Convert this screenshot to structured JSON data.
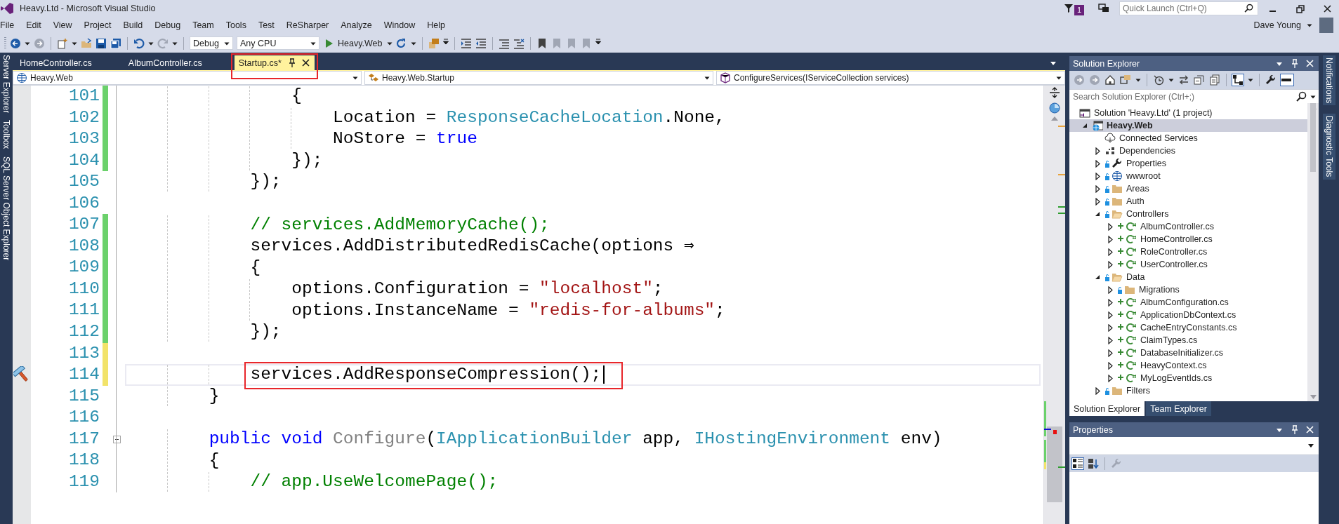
{
  "window": {
    "title": "Heavy.Ltd - Microsoft Visual Studio",
    "notification_count": "1",
    "quick_launch": {
      "placeholder": "Quick Launch (Ctrl+Q)"
    },
    "user": "Dave Young"
  },
  "menu": [
    "File",
    "Edit",
    "View",
    "Project",
    "Build",
    "Debug",
    "Team",
    "Tools",
    "Test",
    "ReSharper",
    "Analyze",
    "Window",
    "Help"
  ],
  "toolbar": {
    "configuration": "Debug",
    "platform": "Any CPU",
    "start_target": "Heavy.Web"
  },
  "left_strip": [
    "Server Explorer",
    "Toolbox",
    "SQL Server Object Explorer"
  ],
  "editor": {
    "tabs": [
      {
        "label": "HomeController.cs",
        "selected": false,
        "highlighted": false
      },
      {
        "label": "AlbumController.cs",
        "selected": false,
        "highlighted": false
      },
      {
        "label": "Startup.cs*",
        "selected": true,
        "highlighted": true
      }
    ],
    "navigation": {
      "project": "Heavy.Web",
      "type": "Heavy.Web.Startup",
      "member": "ConfigureServices(IServiceCollection services)"
    },
    "lines": [
      {
        "number": "101",
        "tokens": [
          {
            "text": "                {",
            "kind": "plain"
          }
        ],
        "color": "#6bd16b",
        "current": false,
        "highlighted": false,
        "quick_action": false
      },
      {
        "number": "102",
        "tokens": [
          {
            "text": "                    Location = ",
            "kind": "plain"
          },
          {
            "text": "ResponseCacheLocation",
            "kind": "type"
          },
          {
            "text": ".None,",
            "kind": "plain"
          }
        ],
        "color": "#6bd16b",
        "current": false,
        "highlighted": false,
        "quick_action": false
      },
      {
        "number": "103",
        "tokens": [
          {
            "text": "                    NoStore = ",
            "kind": "plain"
          },
          {
            "text": "true",
            "kind": "keyword"
          }
        ],
        "color": "#6bd16b",
        "current": false,
        "highlighted": false,
        "quick_action": false
      },
      {
        "number": "104",
        "tokens": [
          {
            "text": "                });",
            "kind": "plain"
          }
        ],
        "color": "#6bd16b",
        "current": false,
        "highlighted": false,
        "quick_action": false
      },
      {
        "number": "105",
        "tokens": [
          {
            "text": "            });",
            "kind": "plain"
          }
        ],
        "current": false,
        "highlighted": false,
        "quick_action": false
      },
      {
        "number": "106",
        "current": false,
        "highlighted": false,
        "quick_action": false
      },
      {
        "number": "107",
        "tokens": [
          {
            "text": "            // services.AddMemoryCache();",
            "kind": "comment"
          }
        ],
        "color": "#6bd16b",
        "current": false,
        "highlighted": false,
        "quick_action": false
      },
      {
        "number": "108",
        "tokens": [
          {
            "text": "            services.AddDistributedRedisCache(options ⇒",
            "kind": "plain"
          }
        ],
        "color": "#6bd16b",
        "current": false,
        "highlighted": false,
        "quick_action": false
      },
      {
        "number": "109",
        "tokens": [
          {
            "text": "            {",
            "kind": "plain"
          }
        ],
        "color": "#6bd16b",
        "current": false,
        "highlighted": false,
        "quick_action": false
      },
      {
        "number": "110",
        "tokens": [
          {
            "text": "                options.Configuration = ",
            "kind": "plain"
          },
          {
            "text": "\"localhost\"",
            "kind": "string"
          },
          {
            "text": ";",
            "kind": "plain"
          }
        ],
        "color": "#6bd16b",
        "current": false,
        "highlighted": false,
        "quick_action": false
      },
      {
        "number": "111",
        "tokens": [
          {
            "text": "                options.InstanceName = ",
            "kind": "plain"
          },
          {
            "text": "\"redis-for-albums\"",
            "kind": "string"
          },
          {
            "text": ";",
            "kind": "plain"
          }
        ],
        "color": "#6bd16b",
        "current": false,
        "highlighted": false,
        "quick_action": false
      },
      {
        "number": "112",
        "tokens": [
          {
            "text": "            });",
            "kind": "plain"
          }
        ],
        "color": "#6bd16b",
        "current": false,
        "highlighted": false,
        "quick_action": false
      },
      {
        "number": "113",
        "color": "#f2e36a",
        "current": false,
        "highlighted": false,
        "quick_action": false
      },
      {
        "number": "114",
        "tokens": [
          {
            "text": "            services.AddResponseCompression();",
            "kind": "plain"
          }
        ],
        "color": "#f2e36a",
        "current": true,
        "highlighted": true,
        "quick_action": true
      },
      {
        "number": "115",
        "tokens": [
          {
            "text": "        }",
            "kind": "plain"
          }
        ],
        "current": false,
        "highlighted": false,
        "quick_action": false
      },
      {
        "number": "116",
        "current": false,
        "highlighted": false,
        "quick_action": false
      },
      {
        "number": "117",
        "tokens": [
          {
            "text": "        public ",
            "kind": "keyword"
          },
          {
            "text": "void ",
            "kind": "keyword"
          },
          {
            "text": "Configure",
            "kind": "dim"
          },
          {
            "text": "(",
            "kind": "plain"
          },
          {
            "text": "IApplicationBuilder",
            "kind": "type"
          },
          {
            "text": " app, ",
            "kind": "plain"
          },
          {
            "text": "IHostingEnvironment",
            "kind": "type"
          },
          {
            "text": " env)",
            "kind": "plain"
          }
        ],
        "expanded": true,
        "current": false,
        "highlighted": false,
        "quick_action": false
      },
      {
        "number": "118",
        "tokens": [
          {
            "text": "        {",
            "kind": "plain"
          }
        ],
        "current": false,
        "highlighted": false,
        "quick_action": false
      },
      {
        "number": "119",
        "tokens": [
          {
            "text": "            // app.UseWelcomePage();",
            "kind": "comment"
          }
        ],
        "current": false,
        "highlighted": false,
        "quick_action": false
      }
    ]
  },
  "solution_explorer": {
    "title": "Solution Explorer",
    "search": {
      "placeholder": "Search Solution Explorer (Ctrl+;)"
    },
    "tree": [
      {
        "label": "Solution 'Heavy.Ltd' (1 project)",
        "kind": "solution",
        "selected": false,
        "children": [
          {
            "label": "Heavy.Web",
            "kind": "project",
            "selected": true,
            "expanded": true,
            "children": [
              {
                "label": "Connected Services",
                "kind": "service",
                "selected": false
              },
              {
                "label": "Dependencies",
                "kind": "dependencies",
                "selected": false,
                "expanded": false
              },
              {
                "label": "Properties",
                "kind": "properties",
                "selected": false,
                "expanded": false
              },
              {
                "label": "wwwroot",
                "kind": "globe",
                "selected": false,
                "expanded": false
              },
              {
                "label": "Areas",
                "kind": "folder",
                "selected": false,
                "expanded": false
              },
              {
                "label": "Auth",
                "kind": "folder",
                "selected": false,
                "expanded": false
              },
              {
                "label": "Controllers",
                "kind": "folder",
                "selected": false,
                "expanded": true,
                "children": [
                  {
                    "label": "AlbumController.cs",
                    "kind": "csharp",
                    "selected": false,
                    "expanded": false
                  },
                  {
                    "label": "HomeController.cs",
                    "kind": "csharp",
                    "selected": false,
                    "expanded": false
                  },
                  {
                    "label": "RoleController.cs",
                    "kind": "csharp",
                    "selected": false,
                    "expanded": false
                  },
                  {
                    "label": "UserController.cs",
                    "kind": "csharp",
                    "selected": false,
                    "expanded": false
                  }
                ]
              },
              {
                "label": "Data",
                "kind": "folder",
                "selected": false,
                "expanded": true,
                "children": [
                  {
                    "label": "Migrations",
                    "kind": "folder",
                    "selected": false,
                    "expanded": false
                  },
                  {
                    "label": "AlbumConfiguration.cs",
                    "kind": "csharp",
                    "selected": false,
                    "expanded": false
                  },
                  {
                    "label": "ApplicationDbContext.cs",
                    "kind": "csharp",
                    "selected": false,
                    "expanded": false
                  },
                  {
                    "label": "CacheEntryConstants.cs",
                    "kind": "csharp",
                    "selected": false,
                    "expanded": false
                  },
                  {
                    "label": "ClaimTypes.cs",
                    "kind": "csharp",
                    "selected": false,
                    "expanded": false
                  },
                  {
                    "label": "DatabaseInitializer.cs",
                    "kind": "csharp",
                    "selected": false,
                    "expanded": false
                  },
                  {
                    "label": "HeavyContext.cs",
                    "kind": "csharp",
                    "selected": false,
                    "expanded": false
                  },
                  {
                    "label": "MyLogEventIds.cs",
                    "kind": "csharp",
                    "selected": false,
                    "expanded": false
                  }
                ]
              },
              {
                "label": "Filters",
                "kind": "folder",
                "selected": false,
                "expanded": false
              }
            ]
          }
        ]
      }
    ],
    "tabs": [
      {
        "label": "Solution Explorer",
        "selected": true
      },
      {
        "label": "Team Explorer",
        "selected": false
      }
    ]
  },
  "properties": {
    "title": "Properties"
  },
  "right_strip": [
    "Notifications",
    "Diagnostic Tools"
  ]
}
